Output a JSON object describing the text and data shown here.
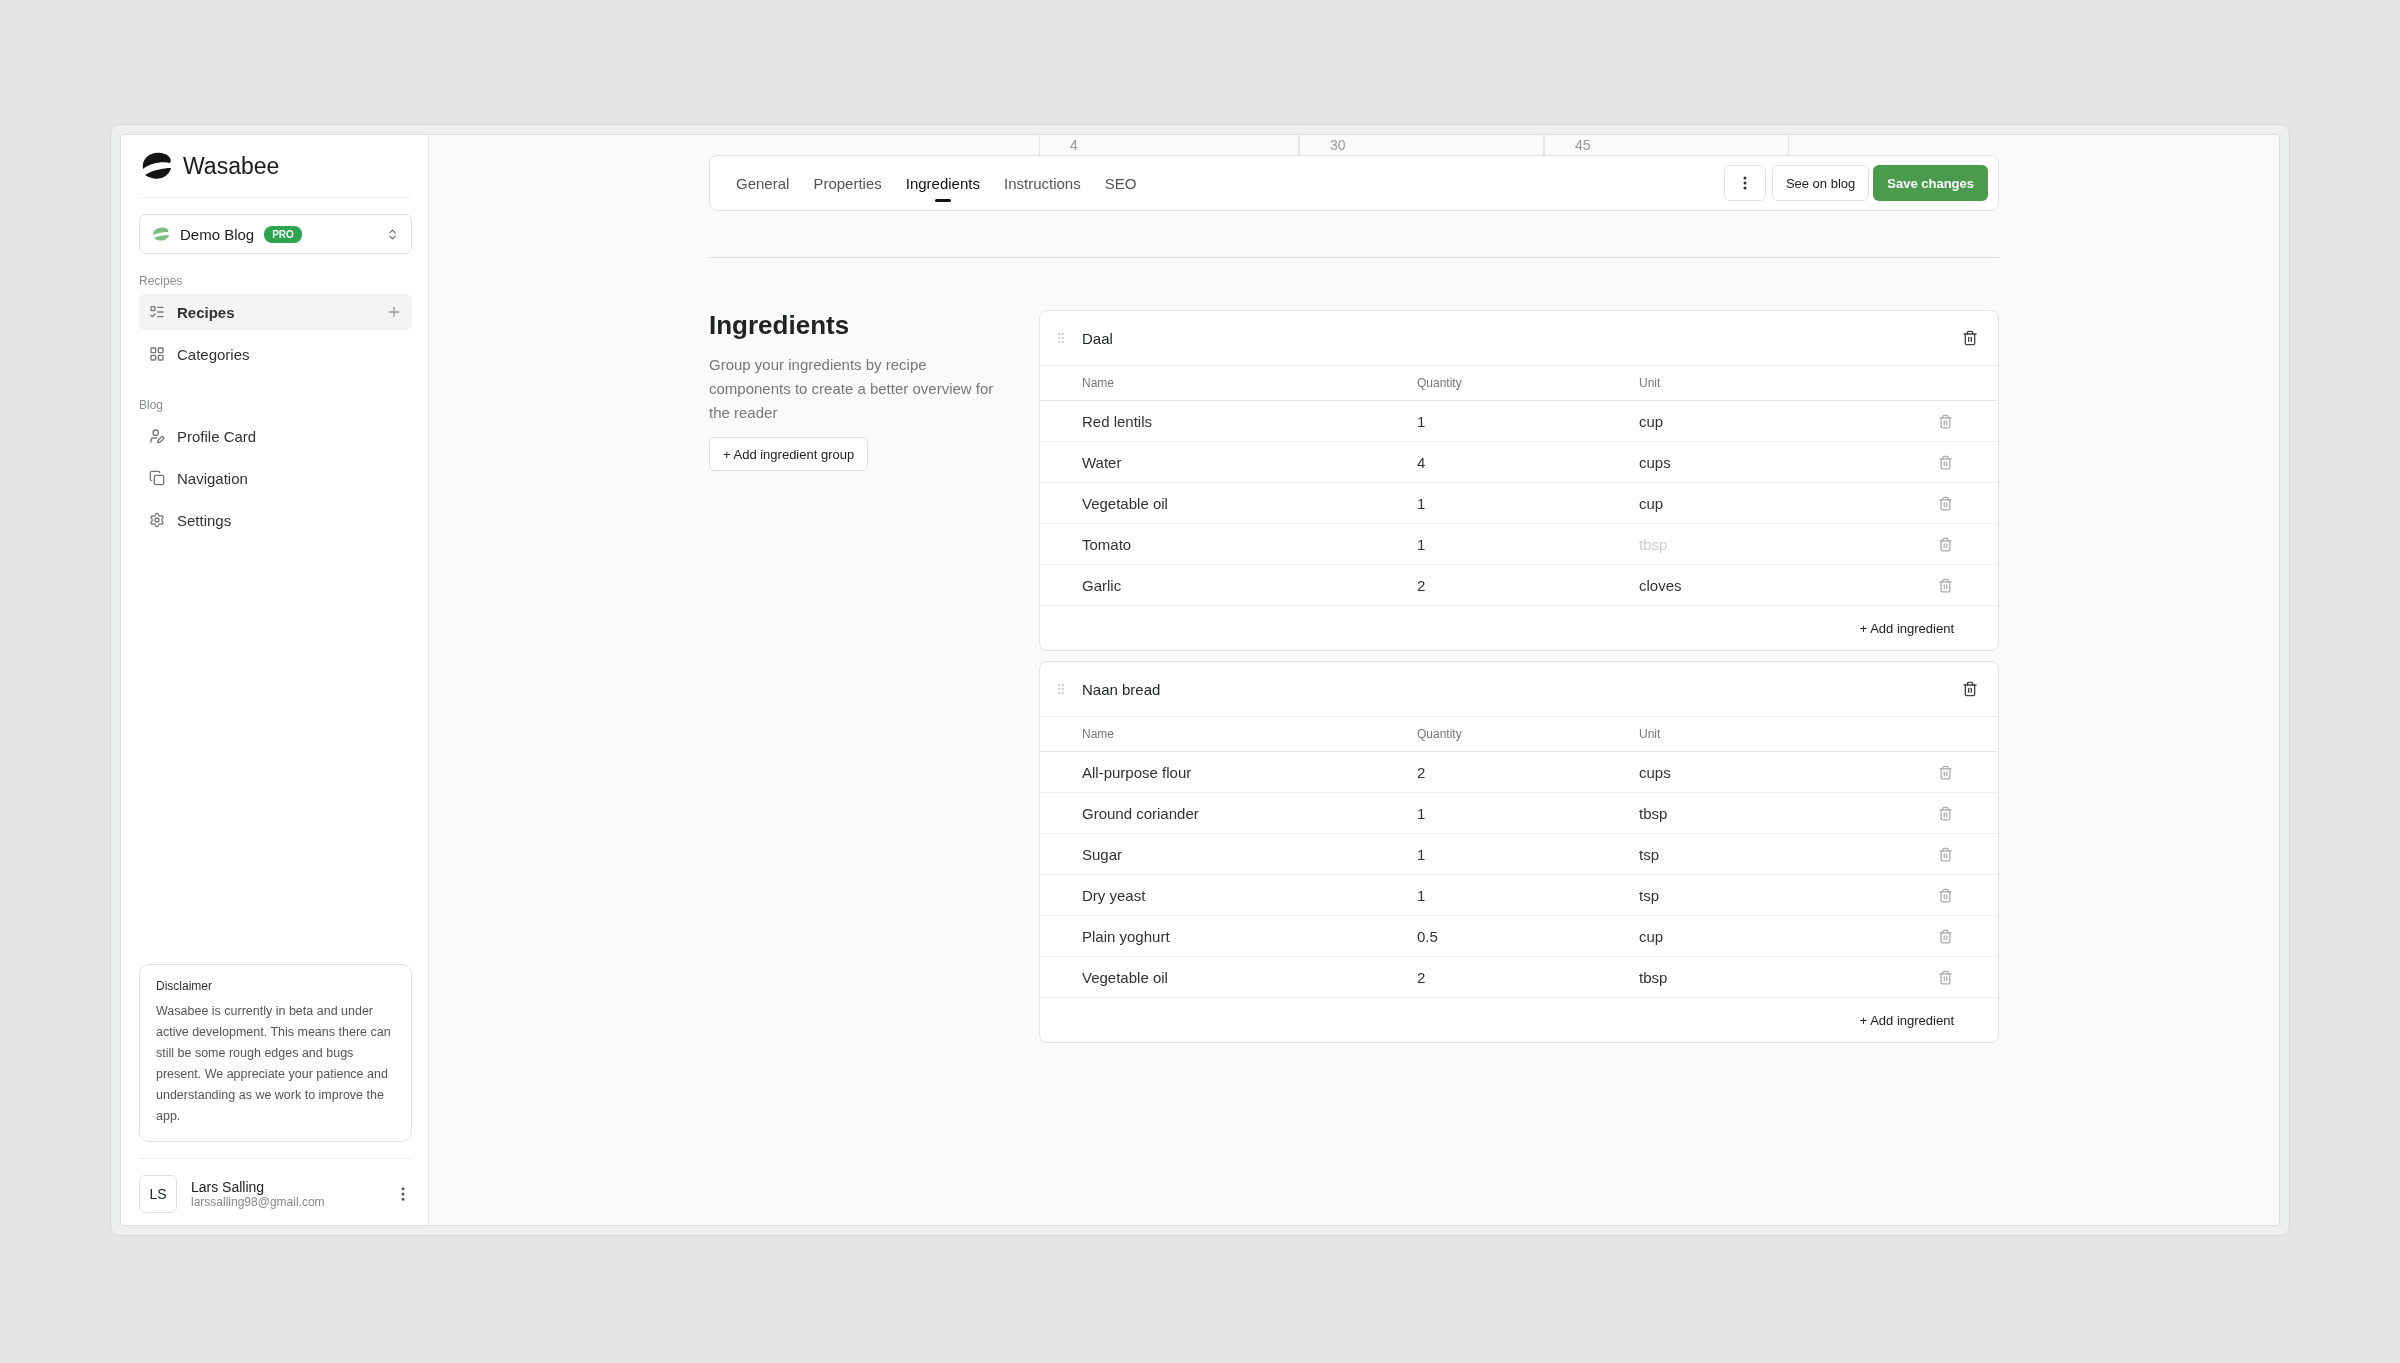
{
  "sidebar": {
    "brand": "Wasabee",
    "workspace": {
      "name": "Demo Blog",
      "badge": "PRO"
    },
    "sections": [
      {
        "title": "Recipes",
        "items": [
          {
            "label": "Recipes",
            "selected": true
          },
          {
            "label": "Categories",
            "selected": false
          }
        ]
      },
      {
        "title": "Blog",
        "items": [
          {
            "label": "Profile Card",
            "selected": false
          },
          {
            "label": "Navigation",
            "selected": false
          },
          {
            "label": "Settings",
            "selected": false
          }
        ]
      }
    ],
    "disclaimer": {
      "title": "Disclaimer",
      "text": "Wasabee is currently in beta and under active development. This means there can still be some rough edges and bugs present. We appreciate your patience and understanding as we work to improve the app."
    },
    "user": {
      "initials": "LS",
      "name": "Lars Salling",
      "email": "larssalling98@gmail.com"
    }
  },
  "scrolled_fields": [
    "4",
    "30",
    "45"
  ],
  "tabs": [
    {
      "label": "General",
      "selected": false
    },
    {
      "label": "Properties",
      "selected": false
    },
    {
      "label": "Ingredients",
      "selected": true
    },
    {
      "label": "Instructions",
      "selected": false
    },
    {
      "label": "SEO",
      "selected": false
    }
  ],
  "actions": {
    "secondary": "See on blog",
    "primary": "Save changes"
  },
  "section": {
    "title": "Ingredients",
    "description": "Group your ingredients by recipe components to create a better overview for the reader",
    "add_group": "+ Add ingredient group"
  },
  "groups": [
    {
      "name": "Daal",
      "columns": [
        "Name",
        "Quantity",
        "Unit"
      ],
      "add": "+ Add ingredient",
      "rows": [
        {
          "name": "Red lentils",
          "quantity": "1",
          "unit": "cup"
        },
        {
          "name": "Water",
          "quantity": "4",
          "unit": "cups"
        },
        {
          "name": "Vegetable oil",
          "quantity": "1",
          "unit": "cup"
        },
        {
          "name": "Tomato",
          "quantity": "1",
          "unit_placeholder": "tbsp"
        },
        {
          "name": "Garlic",
          "quantity": "2",
          "unit": "cloves"
        }
      ]
    },
    {
      "name": "Naan bread",
      "columns": [
        "Name",
        "Quantity",
        "Unit"
      ],
      "add": "+ Add ingredient",
      "rows": [
        {
          "name": "All-purpose flour",
          "quantity": "2",
          "unit": "cups"
        },
        {
          "name": "Ground coriander",
          "quantity": "1",
          "unit": "tbsp"
        },
        {
          "name": "Sugar",
          "quantity": "1",
          "unit": "tsp"
        },
        {
          "name": "Dry yeast",
          "quantity": "1",
          "unit": "tsp"
        },
        {
          "name": "Plain yoghurt",
          "quantity": "0.5",
          "unit": "cup"
        },
        {
          "name": "Vegetable oil",
          "quantity": "2",
          "unit": "tbsp"
        }
      ]
    }
  ]
}
